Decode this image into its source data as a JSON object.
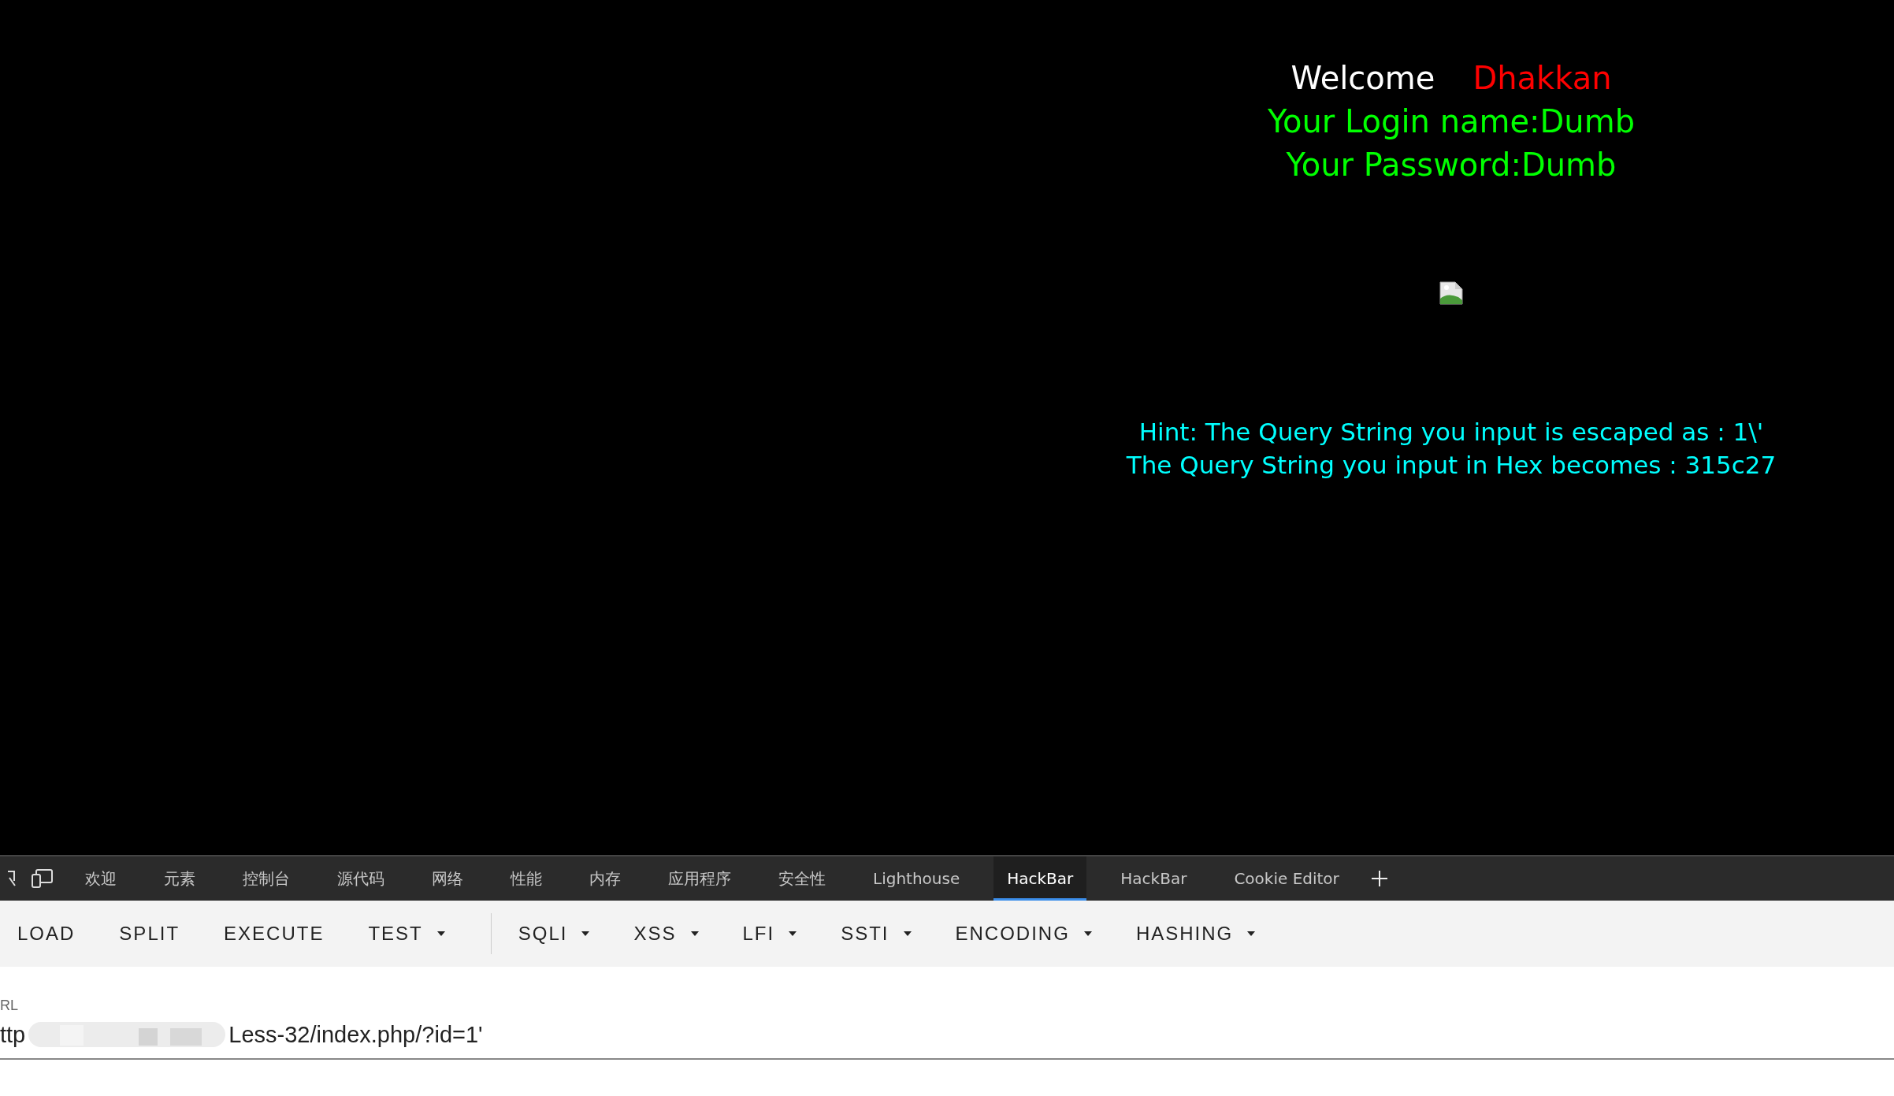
{
  "page": {
    "welcome": "Welcome",
    "user": "Dhakkan",
    "login_line": "Your Login name:Dumb",
    "password_line": "Your Password:Dumb",
    "hint_lines": [
      "Hint: The Query String you input is escaped as : 1\\'",
      "The Query String you input in Hex becomes : 315c27"
    ]
  },
  "devtools_tabs": [
    {
      "label": "欢迎",
      "selected": false
    },
    {
      "label": "元素",
      "selected": false
    },
    {
      "label": "控制台",
      "selected": false
    },
    {
      "label": "源代码",
      "selected": false
    },
    {
      "label": "网络",
      "selected": false
    },
    {
      "label": "性能",
      "selected": false
    },
    {
      "label": "内存",
      "selected": false
    },
    {
      "label": "应用程序",
      "selected": false
    },
    {
      "label": "安全性",
      "selected": false
    },
    {
      "label": "Lighthouse",
      "selected": false
    },
    {
      "label": "HackBar",
      "selected": true
    },
    {
      "label": "HackBar",
      "selected": false
    },
    {
      "label": "Cookie Editor",
      "selected": false
    }
  ],
  "toolbar": {
    "groups": [
      [
        {
          "label": "LOAD",
          "kind": "plain"
        },
        {
          "label": "SPLIT",
          "kind": "plain"
        },
        {
          "label": "EXECUTE",
          "kind": "plain"
        },
        {
          "label": "TEST",
          "kind": "dropdown"
        }
      ],
      [
        {
          "label": "SQLI",
          "kind": "dropdown"
        },
        {
          "label": "XSS",
          "kind": "dropdown"
        },
        {
          "label": "LFI",
          "kind": "dropdown"
        },
        {
          "label": "SSTI",
          "kind": "dropdown"
        },
        {
          "label": "ENCODING",
          "kind": "dropdown"
        },
        {
          "label": "HASHING",
          "kind": "dropdown"
        }
      ]
    ]
  },
  "url_field": {
    "label": "RL",
    "value_start": "ttp",
    "value_end": "Less-32/index.php/?id=1'"
  }
}
